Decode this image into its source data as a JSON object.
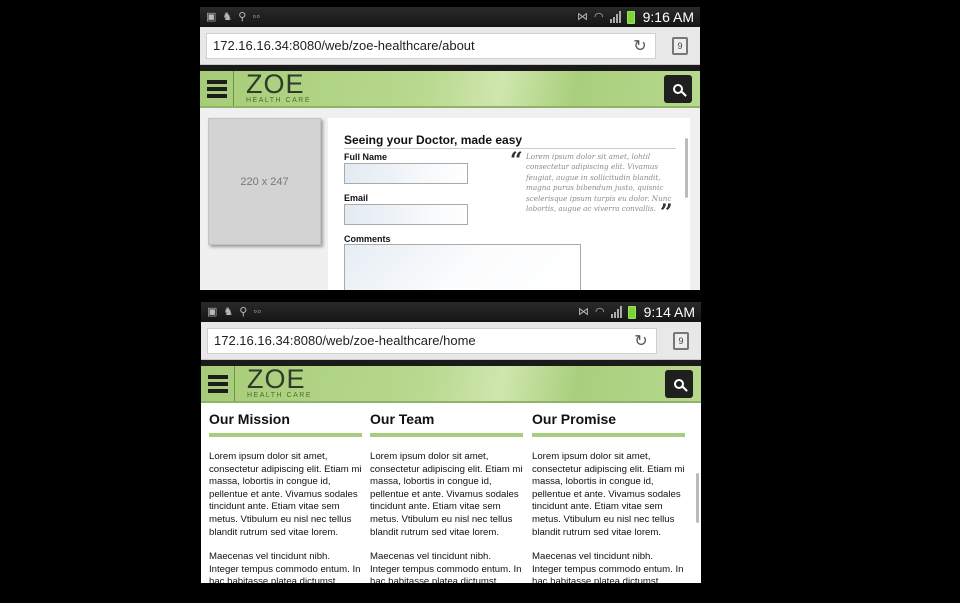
{
  "screens": [
    {
      "status": {
        "time": "9:16 AM"
      },
      "url": "172.16.16.34:8080/web/zoe-healthcare/about",
      "tab_count": "9"
    },
    {
      "status": {
        "time": "9:14 AM"
      },
      "url": "172.16.16.34:8080/web/zoe-healthcare/home",
      "tab_count": "9"
    }
  ],
  "brand": {
    "name": "ZOE",
    "tagline": "HEALTH CARE",
    "accent": "#a9cd7f"
  },
  "about": {
    "image_placeholder": "220 x 247",
    "form_title": "Seeing your Doctor, made easy",
    "labels": {
      "full_name": "Full Name",
      "email": "Email",
      "comments": "Comments"
    },
    "quote": "Lorem ipsum dolor sit amet, lohtil consectetur adipiscing elit. Vivamus feugiat, augue in sollicitudin blandit, magna purus bibendum justo, quisnic scelerisque ipsum turpis eu dolor. Nunc lobortis, augue ac viverra convallis."
  },
  "home": {
    "columns": [
      {
        "title": "Our Mission",
        "p1": "Lorem ipsum dolor sit amet, consectetur adipiscing elit. Etiam mi massa, lobortis in congue id, pellentue et ante. Vivamus sodales tincidunt ante. Etiam vitae sem metus. Vtibulum eu nisl nec tellus blandit rutrum sed vitae lorem.",
        "p2": "Maecenas vel tincidunt nibh. Integer tempus commodo entum. In hac habitasse platea dictumst."
      },
      {
        "title": "Our Team",
        "p1": "Lorem ipsum dolor sit amet, consectetur adipiscing elit. Etiam mi massa, lobortis in congue id, pellentue et ante. Vivamus sodales tincidunt ante. Etiam vitae sem metus. Vtibulum eu nisl nec tellus blandit rutrum sed vitae lorem.",
        "p2": "Maecenas vel tincidunt nibh. Integer tempus commodo entum. In hac habitasse platea dictumst."
      },
      {
        "title": "Our Promise",
        "p1": "Lorem ipsum dolor sit amet, consectetur adipiscing elit. Etiam mi massa, lobortis in congue id, pellentue et ante. Vivamus sodales tincidunt ante. Etiam vitae sem metus. Vtibulum eu nisl nec tellus blandit rutrum sed vitae lorem.",
        "p2": "Maecenas vel tincidunt nibh. Integer tempus commodo entum. In hac habitasse platea dictumst. Maecenas"
      }
    ]
  },
  "icons": [
    "image-icon",
    "cat-icon",
    "search-icon",
    "voicemail-icon",
    "vibrate-icon",
    "wifi-icon",
    "signal-icon",
    "battery-icon",
    "reload-icon",
    "tabs-icon",
    "menu-icon",
    "quote-open-icon",
    "quote-close-icon"
  ]
}
